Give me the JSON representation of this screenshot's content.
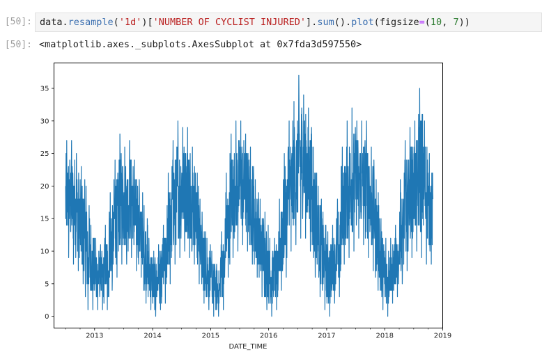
{
  "cell": {
    "input_prompt": "[50]:",
    "output_prompt": "[50]:",
    "code_tokens": [
      {
        "t": "data.",
        "c": ""
      },
      {
        "t": "resample",
        "c": "fn"
      },
      {
        "t": "(",
        "c": ""
      },
      {
        "t": "'1d'",
        "c": "str"
      },
      {
        "t": ")[",
        "c": ""
      },
      {
        "t": "'NUMBER OF CYCLIST INJURED'",
        "c": "str"
      },
      {
        "t": "].",
        "c": ""
      },
      {
        "t": "sum",
        "c": "fn"
      },
      {
        "t": "().",
        "c": ""
      },
      {
        "t": "plot",
        "c": "fn"
      },
      {
        "t": "(figsize",
        "c": ""
      },
      {
        "t": "=",
        "c": "op"
      },
      {
        "t": "(",
        "c": ""
      },
      {
        "t": "10",
        "c": "num"
      },
      {
        "t": ", ",
        "c": ""
      },
      {
        "t": "7",
        "c": "num"
      },
      {
        "t": "))",
        "c": ""
      }
    ],
    "output_text": "<matplotlib.axes._subplots.AxesSubplot at 0x7fda3d597550>"
  },
  "chart_data": {
    "type": "line",
    "title": "",
    "xlabel": "DATE_TIME",
    "ylabel": "",
    "line_color": "#1f77b4",
    "xlim": [
      2012.3,
      2019.0
    ],
    "ylim": [
      -1.8,
      38.9
    ],
    "x_ticks": [
      2013,
      2014,
      2015,
      2016,
      2017,
      2018,
      2019
    ],
    "x_tick_labels": [
      "2013",
      "2014",
      "2015",
      "2016",
      "2017",
      "2018",
      "2019"
    ],
    "y_ticks": [
      0,
      5,
      10,
      15,
      20,
      25,
      30,
      35
    ],
    "y_tick_labels": [
      "0",
      "5",
      "10",
      "15",
      "20",
      "25",
      "30",
      "35"
    ],
    "grid": false,
    "legend": "none",
    "series_note": "daily sums aggregated to monthly [min, max] envelopes",
    "series": [
      {
        "name": "NUMBER OF CYCLIST INJURED",
        "start": "2012-07",
        "monthly_min_max": [
          [
            9,
            27
          ],
          [
            8,
            27
          ],
          [
            7,
            25
          ],
          [
            5,
            23
          ],
          [
            1,
            20
          ],
          [
            1,
            14
          ],
          [
            1,
            12
          ],
          [
            1,
            11
          ],
          [
            1,
            14
          ],
          [
            4,
            19
          ],
          [
            6,
            24
          ],
          [
            8,
            28
          ],
          [
            8,
            26
          ],
          [
            9,
            27
          ],
          [
            7,
            24
          ],
          [
            6,
            21
          ],
          [
            2,
            17
          ],
          [
            1,
            12
          ],
          [
            0,
            10
          ],
          [
            1,
            11
          ],
          [
            2,
            14
          ],
          [
            5,
            22
          ],
          [
            8,
            27
          ],
          [
            9,
            30
          ],
          [
            10,
            29
          ],
          [
            9,
            29
          ],
          [
            8,
            26
          ],
          [
            5,
            22
          ],
          [
            2,
            16
          ],
          [
            1,
            12
          ],
          [
            0,
            10
          ],
          [
            0,
            8
          ],
          [
            1,
            13
          ],
          [
            6,
            22
          ],
          [
            9,
            28
          ],
          [
            10,
            30
          ],
          [
            11,
            30
          ],
          [
            10,
            28
          ],
          [
            8,
            26
          ],
          [
            6,
            21
          ],
          [
            3,
            18
          ],
          [
            1,
            16
          ],
          [
            0,
            12
          ],
          [
            1,
            12
          ],
          [
            4,
            18
          ],
          [
            6,
            25
          ],
          [
            10,
            30
          ],
          [
            11,
            33
          ],
          [
            12,
            37
          ],
          [
            12,
            34
          ],
          [
            10,
            32
          ],
          [
            6,
            26
          ],
          [
            3,
            20
          ],
          [
            1,
            16
          ],
          [
            0,
            13
          ],
          [
            2,
            14
          ],
          [
            3,
            18
          ],
          [
            8,
            26
          ],
          [
            9,
            30
          ],
          [
            10,
            32
          ],
          [
            12,
            30
          ],
          [
            11,
            30
          ],
          [
            9,
            30
          ],
          [
            7,
            26
          ],
          [
            4,
            21
          ],
          [
            1,
            15
          ],
          [
            0,
            12
          ],
          [
            2,
            12
          ],
          [
            3,
            14
          ],
          [
            5,
            21
          ],
          [
            7,
            27
          ],
          [
            9,
            29
          ],
          [
            10,
            30
          ],
          [
            9,
            35
          ],
          [
            8,
            30
          ],
          [
            8,
            25
          ]
        ]
      }
    ]
  }
}
